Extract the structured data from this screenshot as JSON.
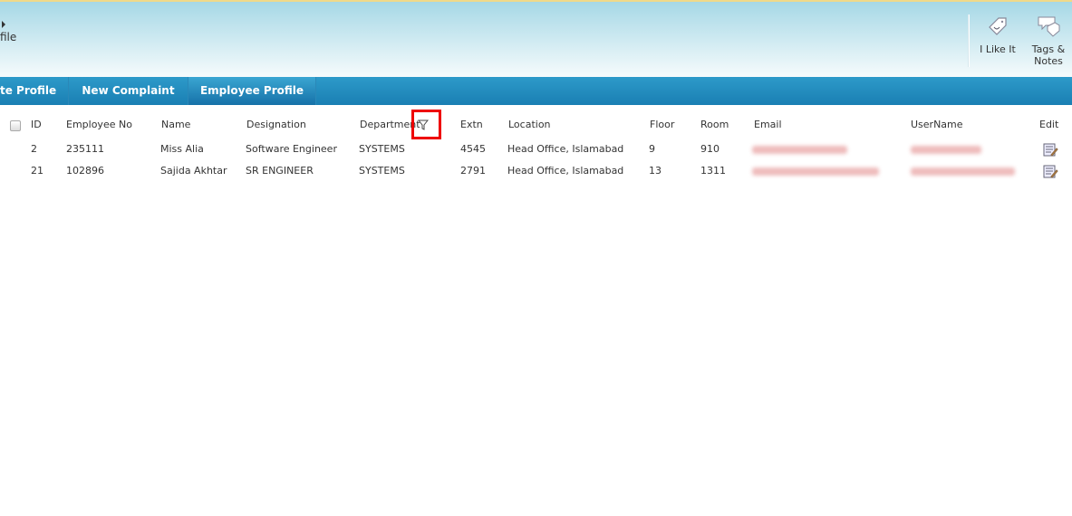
{
  "ribbon": {
    "breadcrumb": "file",
    "buttons": [
      {
        "label": "I Like It"
      },
      {
        "label": "Tags &"
      }
    ],
    "tags_second_line": "Notes"
  },
  "nav": {
    "tabs": [
      {
        "label": "te Profile"
      },
      {
        "label": "New Complaint"
      },
      {
        "label": "Employee Profile",
        "selected": true
      }
    ]
  },
  "table": {
    "headers": {
      "id": "ID",
      "emp_no": "Employee No",
      "name": "Name",
      "designation": "Designation",
      "department": "Department",
      "extn": "Extn",
      "location": "Location",
      "floor": "Floor",
      "room": "Room",
      "email": "Email",
      "username": "UserName",
      "edit": "Edit"
    },
    "rows": [
      {
        "id": "2",
        "emp_no": "235111",
        "name": "Miss Alia",
        "designation": "Software Engineer",
        "department": "SYSTEMS",
        "extn": "4545",
        "location": "Head Office, Islamabad",
        "floor": "9",
        "room": "910"
      },
      {
        "id": "21",
        "emp_no": "102896",
        "name": "Sajida Akhtar",
        "designation": "SR ENGINEER",
        "department": "SYSTEMS",
        "extn": "2791",
        "location": "Head Office, Islamabad",
        "floor": "13",
        "room": "1311"
      }
    ]
  },
  "colors": {
    "nav": "#1f88bd",
    "highlight": "#e00000"
  }
}
